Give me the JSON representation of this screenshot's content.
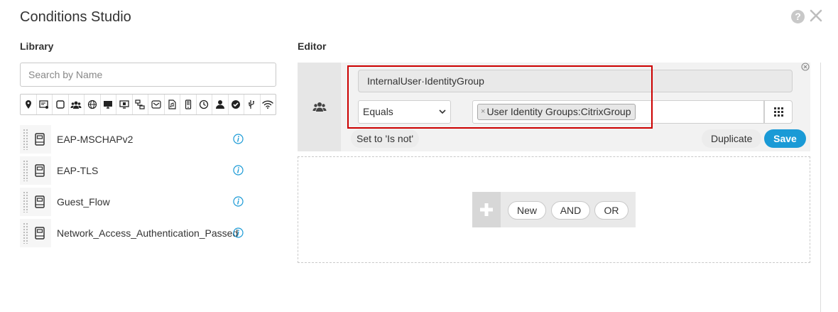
{
  "window": {
    "title": "Conditions Studio"
  },
  "library": {
    "heading": "Library",
    "search_placeholder": "Search by Name",
    "filter_icons": [
      "location-icon",
      "device-card-icon",
      "square-icon",
      "group-icon",
      "globe-icon",
      "monitor-icon",
      "monitor-settings-icon",
      "network-icon",
      "mail-icon",
      "file-icon",
      "mobile-icon",
      "clock-icon",
      "user-icon",
      "check-circle-icon",
      "usb-icon",
      "wifi-icon"
    ],
    "items": [
      {
        "label": "EAP-MSCHAPv2"
      },
      {
        "label": "EAP-TLS"
      },
      {
        "label": "Guest_Flow"
      },
      {
        "label": "Network_Access_Authentication_Passed"
      }
    ]
  },
  "editor": {
    "heading": "Editor",
    "attribute": "InternalUser·IdentityGroup",
    "operator": "Equals",
    "value_tag": "User Identity Groups:CitrixGroup",
    "set_is_not": "Set to 'Is not'",
    "duplicate": "Duplicate",
    "save": "Save",
    "adder": {
      "new": "New",
      "and": "AND",
      "or": "OR"
    }
  },
  "colors": {
    "accent": "#1a9ad6",
    "highlight": "#cc0000",
    "info": "#1a9ad6"
  }
}
